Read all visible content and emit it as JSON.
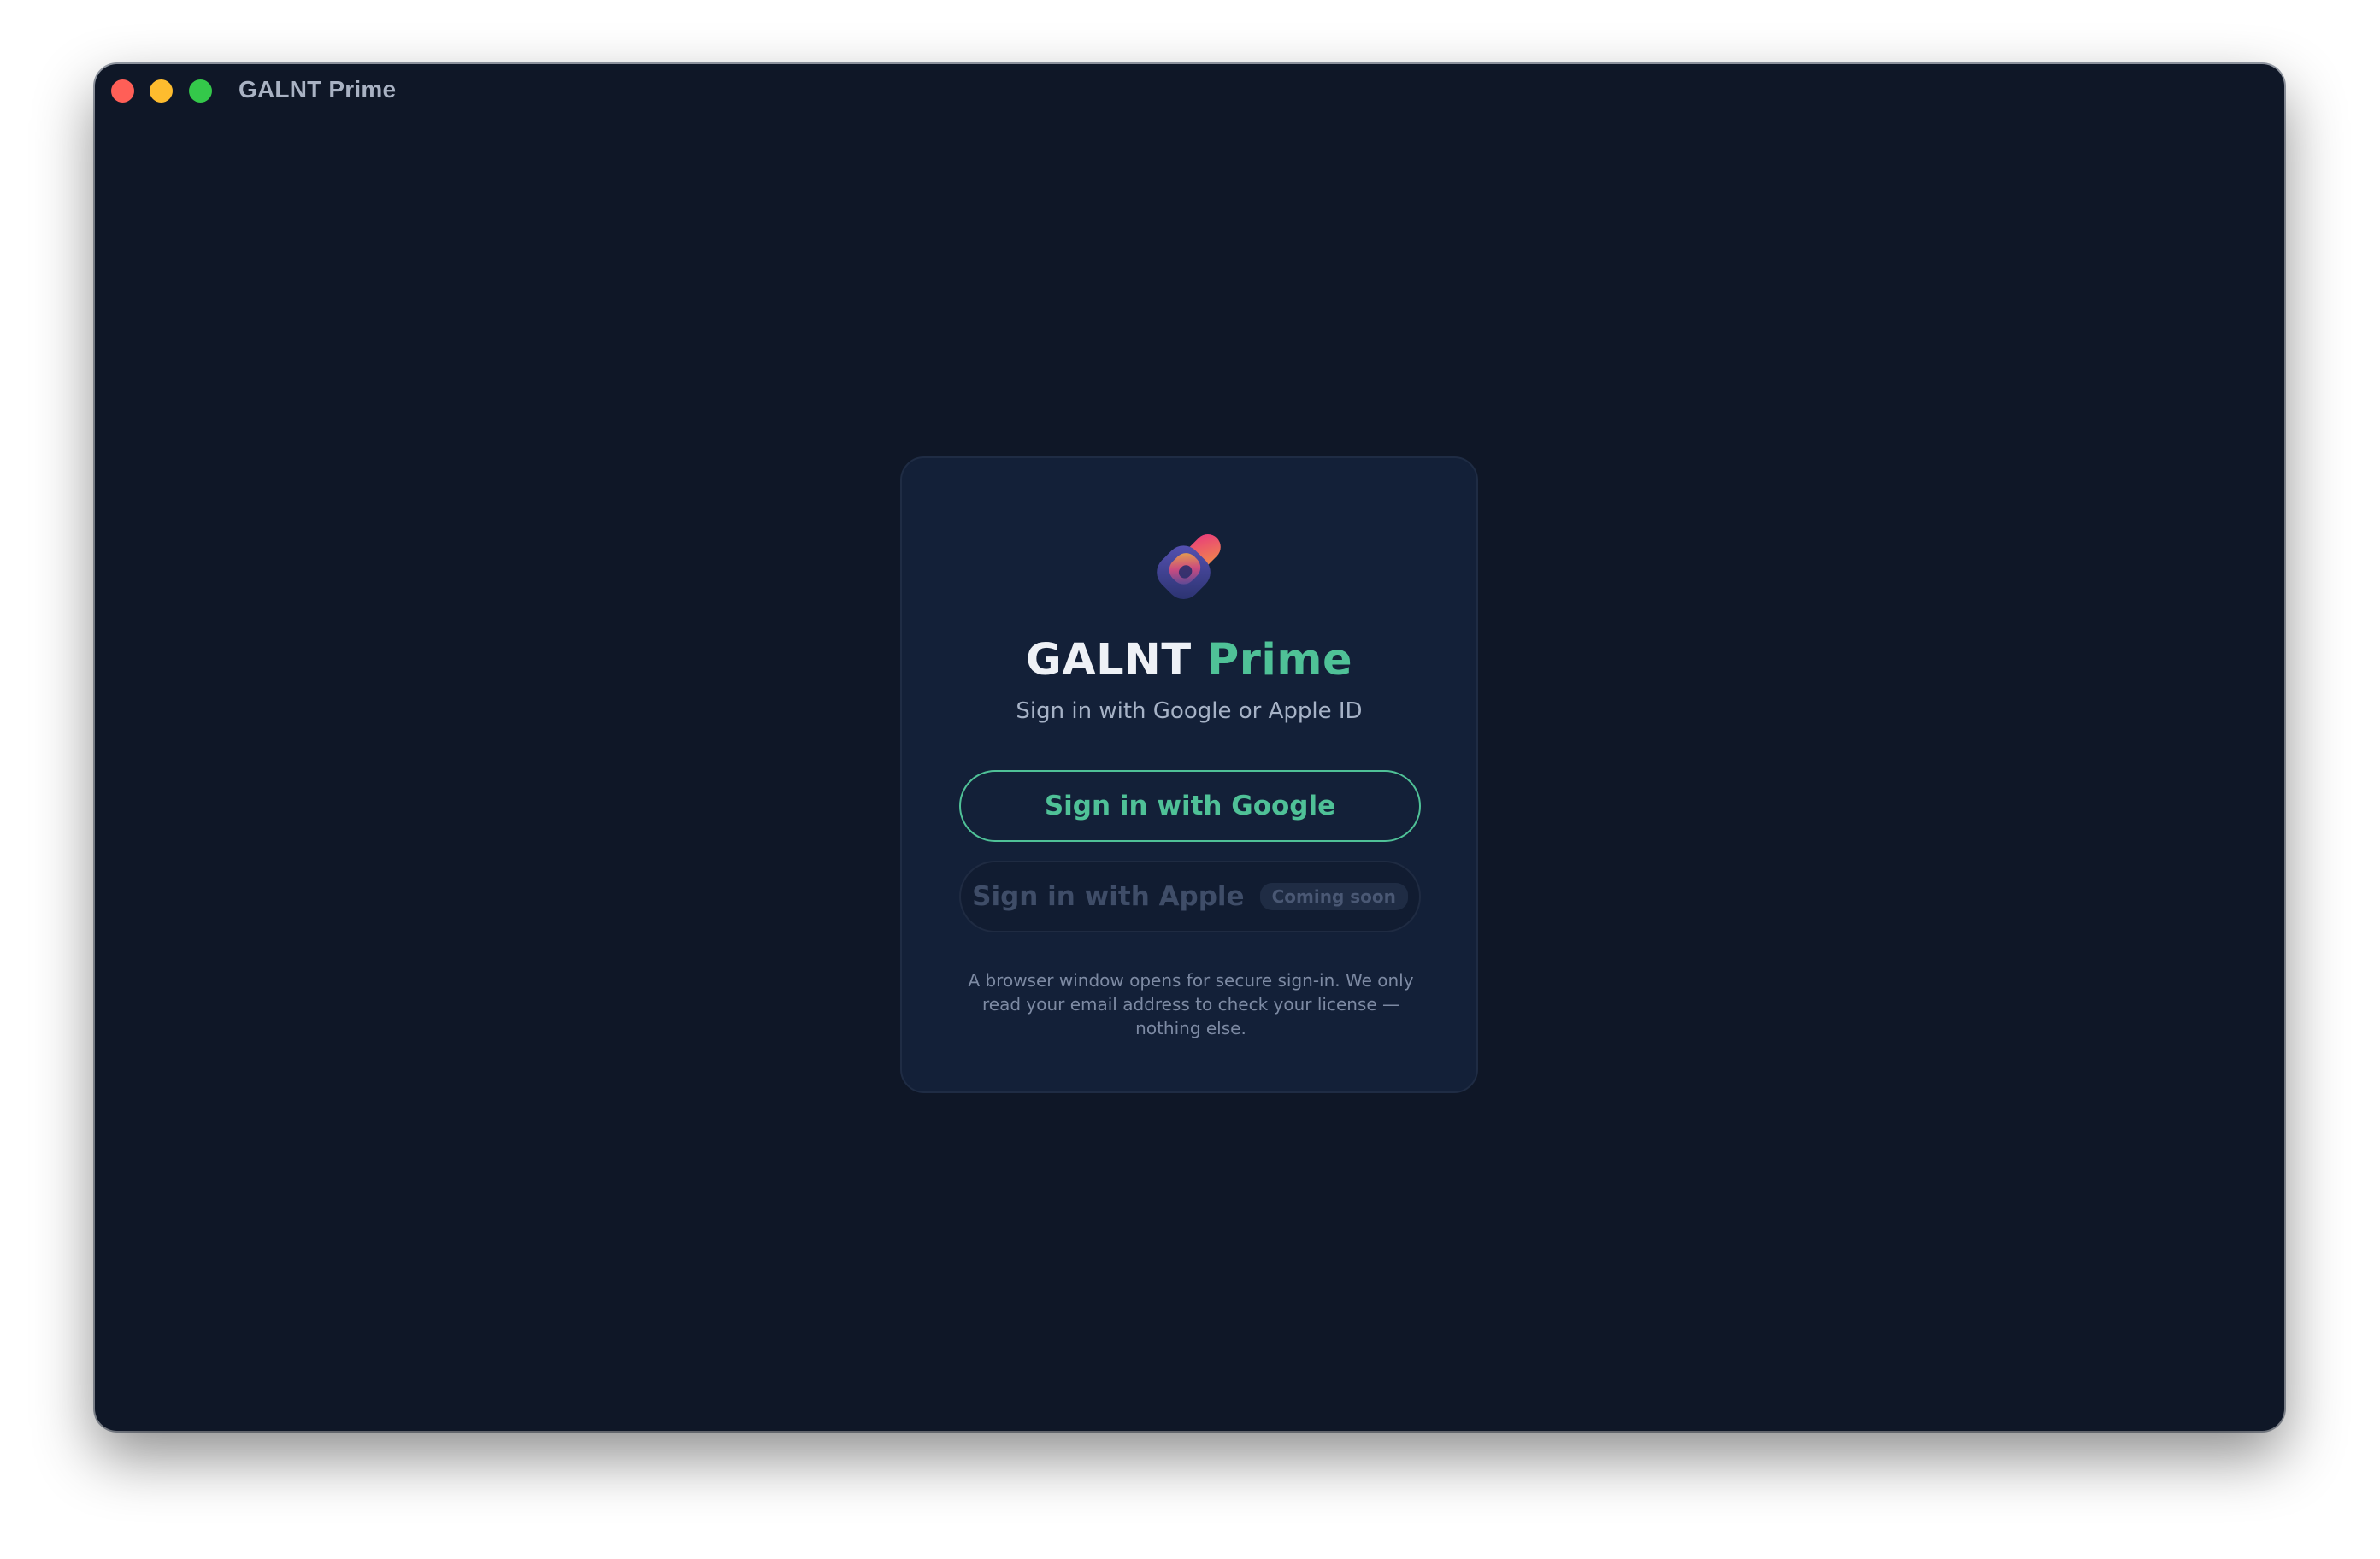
{
  "window": {
    "title": "GALNT Prime"
  },
  "signin": {
    "brand_main": "GALNT",
    "brand_accent": "Prime",
    "subtitle": "Sign in with Google or Apple ID",
    "google_button_label": "Sign in with Google",
    "apple_button_label": "Sign in with Apple",
    "apple_badge": "Coming soon",
    "footnote": "A browser window opens for secure sign-in. We only read your email address to check your license — nothing else."
  },
  "icons": {
    "close": "close-window-icon",
    "minimize": "minimize-window-icon",
    "maximize": "maximize-window-icon",
    "logo": "galnt-prime-logo"
  },
  "colors": {
    "accent": "#4fc197",
    "background": "#0f1727",
    "card": "#132038"
  }
}
